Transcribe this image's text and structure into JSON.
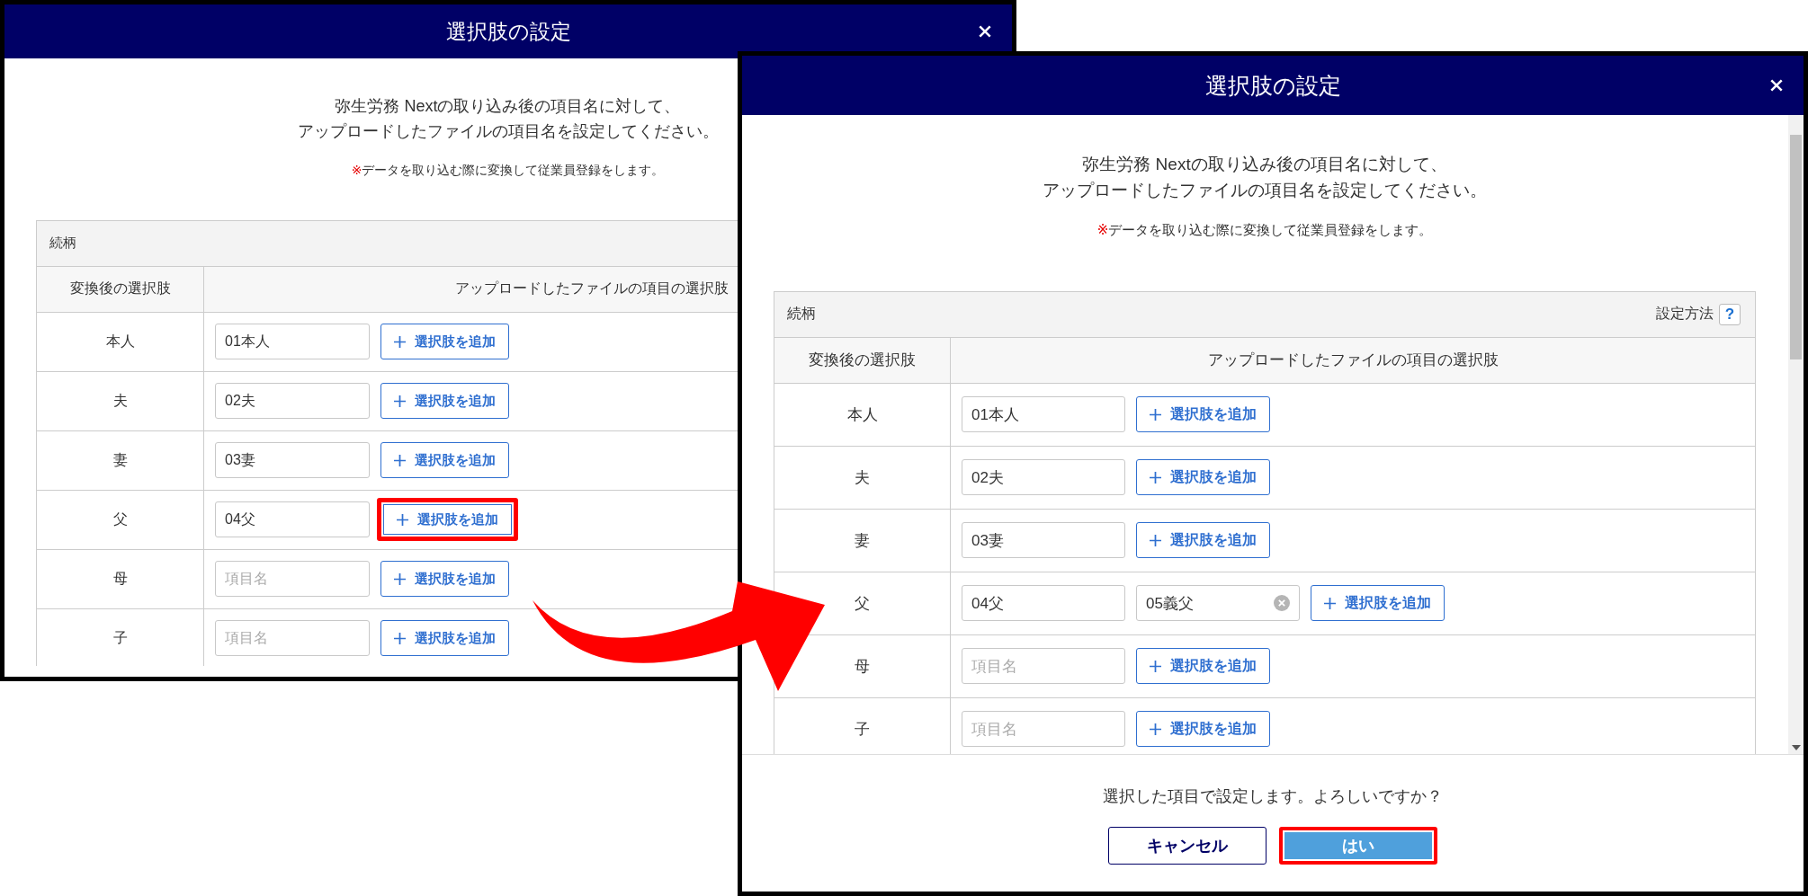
{
  "dialogs": [
    {
      "title": "選択肢の設定",
      "intro_lines": [
        "弥生労務 Nextの取り込み後の項目名に対して、",
        "アップロードしたファイルの項目名を設定してください。"
      ],
      "note_mark": "※",
      "note": "データを取り込む際に変換して従業員登録をします。",
      "table": {
        "section": "続柄",
        "columns": [
          "変換後の選択肢",
          "アップロードしたファイルの項目の選択肢"
        ],
        "rows": [
          {
            "label": "本人",
            "fields": [
              {
                "value": "01本人",
                "removable": false
              }
            ],
            "add_button": {
              "label": "選択肢を追加",
              "highlighted": false
            }
          },
          {
            "label": "夫",
            "fields": [
              {
                "value": "02夫",
                "removable": false
              }
            ],
            "add_button": {
              "label": "選択肢を追加",
              "highlighted": false
            }
          },
          {
            "label": "妻",
            "fields": [
              {
                "value": "03妻",
                "removable": false
              }
            ],
            "add_button": {
              "label": "選択肢を追加",
              "highlighted": false
            }
          },
          {
            "label": "父",
            "fields": [
              {
                "value": "04父",
                "removable": false
              }
            ],
            "add_button": {
              "label": "選択肢を追加",
              "highlighted": true
            }
          },
          {
            "label": "母",
            "fields": [
              {
                "placeholder": "項目名",
                "removable": false
              }
            ],
            "add_button": {
              "label": "選択肢を追加",
              "highlighted": false
            }
          },
          {
            "label": "子",
            "fields": [
              {
                "placeholder": "項目名",
                "removable": false
              }
            ],
            "add_button": {
              "label": "選択肢を追加",
              "highlighted": false
            }
          }
        ]
      }
    },
    {
      "title": "選択肢の設定",
      "intro_lines": [
        "弥生労務 Nextの取り込み後の項目名に対して、",
        "アップロードしたファイルの項目名を設定してください。"
      ],
      "note_mark": "※",
      "note": "データを取り込む際に変換して従業員登録をします。",
      "table": {
        "section": "続柄",
        "help_label": "設定方法",
        "help_button": "?",
        "columns": [
          "変換後の選択肢",
          "アップロードしたファイルの項目の選択肢"
        ],
        "rows": [
          {
            "label": "本人",
            "fields": [
              {
                "value": "01本人",
                "removable": false
              }
            ],
            "add_button": {
              "label": "選択肢を追加",
              "highlighted": false
            }
          },
          {
            "label": "夫",
            "fields": [
              {
                "value": "02夫",
                "removable": false
              }
            ],
            "add_button": {
              "label": "選択肢を追加",
              "highlighted": false
            }
          },
          {
            "label": "妻",
            "fields": [
              {
                "value": "03妻",
                "removable": false
              }
            ],
            "add_button": {
              "label": "選択肢を追加",
              "highlighted": false
            }
          },
          {
            "label": "父",
            "fields": [
              {
                "value": "04父",
                "removable": false
              },
              {
                "value": "05義父",
                "removable": true
              }
            ],
            "add_button": {
              "label": "選択肢を追加",
              "highlighted": false
            }
          },
          {
            "label": "母",
            "fields": [
              {
                "placeholder": "項目名",
                "removable": false
              }
            ],
            "add_button": {
              "label": "選択肢を追加",
              "highlighted": false
            }
          },
          {
            "label": "子",
            "fields": [
              {
                "placeholder": "項目名",
                "removable": false
              }
            ],
            "add_button": {
              "label": "選択肢を追加",
              "highlighted": false
            }
          }
        ]
      },
      "footer": {
        "question": "選択した項目で設定します。よろしいですか？",
        "buttons": [
          {
            "label": "キャンセル",
            "kind": "secondary",
            "highlighted": false
          },
          {
            "label": "はい",
            "kind": "primary",
            "highlighted": true
          }
        ]
      }
    }
  ]
}
